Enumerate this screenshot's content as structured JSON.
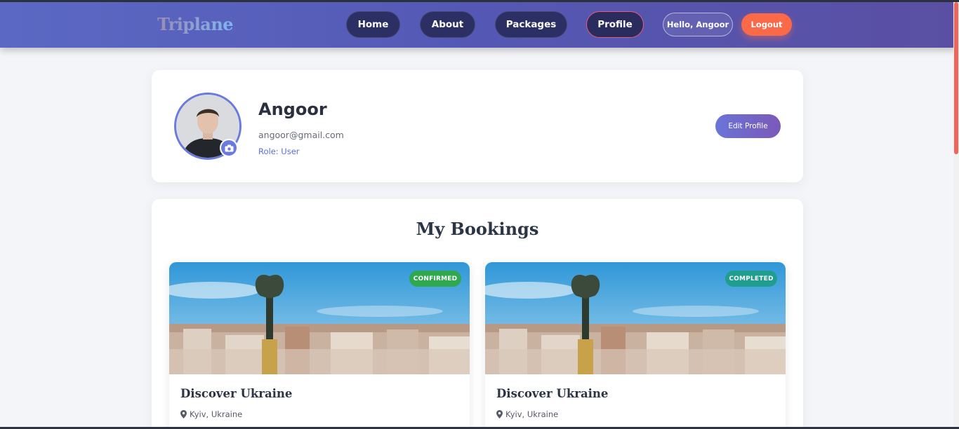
{
  "nav": {
    "brand": "Triplane",
    "links": [
      "Home",
      "About",
      "Packages",
      "Profile"
    ],
    "active": "Profile",
    "greeting": "Hello, Angoor",
    "logout_label": "Logout"
  },
  "profile": {
    "name": "Angoor",
    "email": "angoor@gmail.com",
    "role": "Role: User",
    "edit_label": "Edit Profile"
  },
  "bookings": {
    "title": "My Bookings",
    "items": [
      {
        "name": "Discover Ukraine",
        "location": "Kyiv, Ukraine",
        "status": "CONFIRMED",
        "status_color": "#2fa84f"
      },
      {
        "name": "Discover Ukraine",
        "location": "Kyiv, Ukraine",
        "status": "COMPLETED",
        "status_color": "#1f9d8e"
      }
    ]
  },
  "colors": {
    "accent": "#5b69c4",
    "logout": "#fa6a49",
    "nav_pill": "#2b2f63"
  }
}
